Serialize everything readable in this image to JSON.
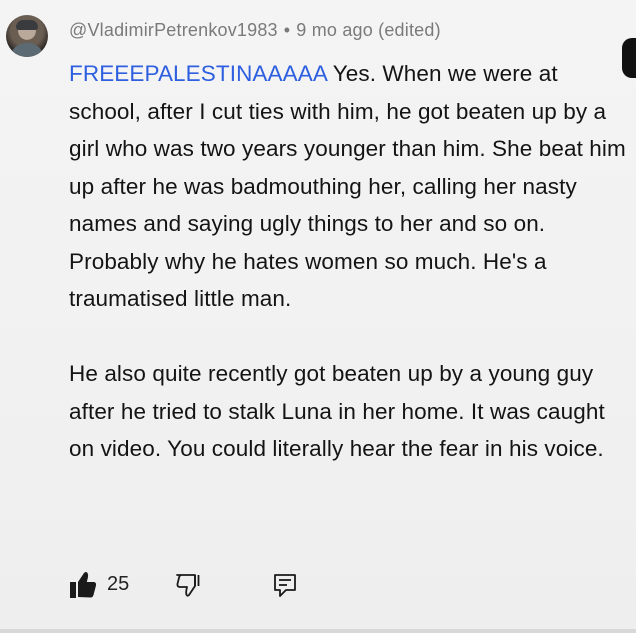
{
  "comment": {
    "author": "@VladimirPetrenkov1983",
    "separator": "•",
    "timestamp": "9 mo ago (edited)",
    "mention": "FREEEPALESTINAAAAA",
    "paragraph1": "Yes. When we were at school, after I cut ties with him, he got beaten up by a girl who was two years younger than him. She beat him up after he was badmouthing her, calling her nasty names and saying ugly things to her and so on. Probably why he hates women so much. He's a traumatised little man.",
    "paragraph2": "He also quite recently got beaten up by a young guy after he tried to stalk Luna in her home.  It was caught on video. You could literally hear the fear in his voice."
  },
  "actions": {
    "like_count": "25",
    "like_icon": "thumbs-up-icon",
    "dislike_icon": "thumbs-down-icon",
    "reply_icon": "reply-icon"
  },
  "colors": {
    "mention": "#2d5fe0",
    "meta_text": "#7a7a7a",
    "body_text": "#141414",
    "background": "#f2f2f2"
  }
}
